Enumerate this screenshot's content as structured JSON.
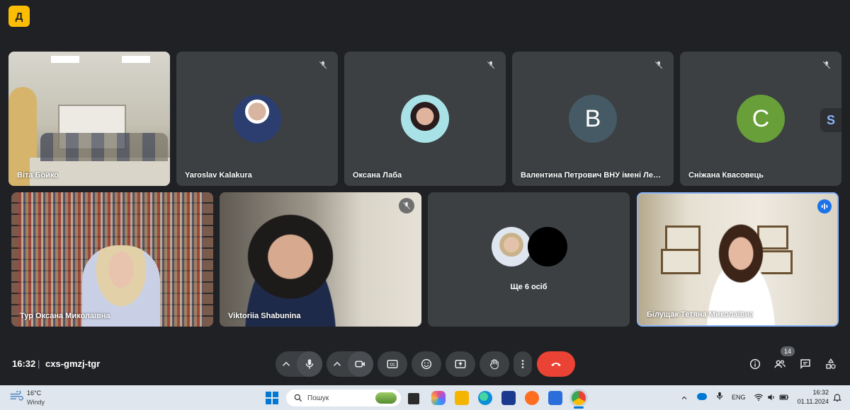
{
  "app": {
    "logo_text": "Д",
    "time": "16:32",
    "separator": "|",
    "meeting_code": "cxs-gmzj-tgr"
  },
  "tiles_top": [
    {
      "name": "Віта Бойко",
      "type": "video"
    },
    {
      "name": "Yaroslav Kalakura",
      "type": "photo",
      "muted": true
    },
    {
      "name": "Оксана Лаба",
      "type": "photo",
      "muted": true
    },
    {
      "name": "Валентина Петрович ВНУ імені Лесі У...",
      "type": "letter",
      "letter": "B",
      "color": "#455a64",
      "muted": true
    },
    {
      "name": "Сніжана Квасовець",
      "type": "letter",
      "letter": "C",
      "color": "#689f38",
      "muted": true
    }
  ],
  "tiles_bottom": [
    {
      "name": "Тур Оксана Миколаївна",
      "type": "video"
    },
    {
      "name": "Viktoriia Shabunina",
      "type": "video",
      "muted": true
    },
    {
      "name": "",
      "type": "others",
      "others_label": "Ще 6 осіб"
    },
    {
      "name": "Білущак Тетяна Миколаївна",
      "type": "video",
      "speaking": true
    }
  ],
  "people_count": "14",
  "controls": [
    "chevron-up-icon",
    "mic-icon",
    "chevron-up-icon",
    "camera-icon",
    "captions-icon",
    "emoji-icon",
    "present-icon",
    "raise-hand-icon",
    "more-icon",
    "end-call-icon"
  ],
  "colors": {
    "end_call": "#ea4335",
    "accent": "#8ab4f8",
    "logo": "#fbbc04"
  },
  "taskbar": {
    "weather_temp": "16°C",
    "weather_desc": "Windy",
    "search_placeholder": "Пошук",
    "lang": "ENG",
    "clock_time": "16:32",
    "clock_date": "01.11.2024"
  }
}
